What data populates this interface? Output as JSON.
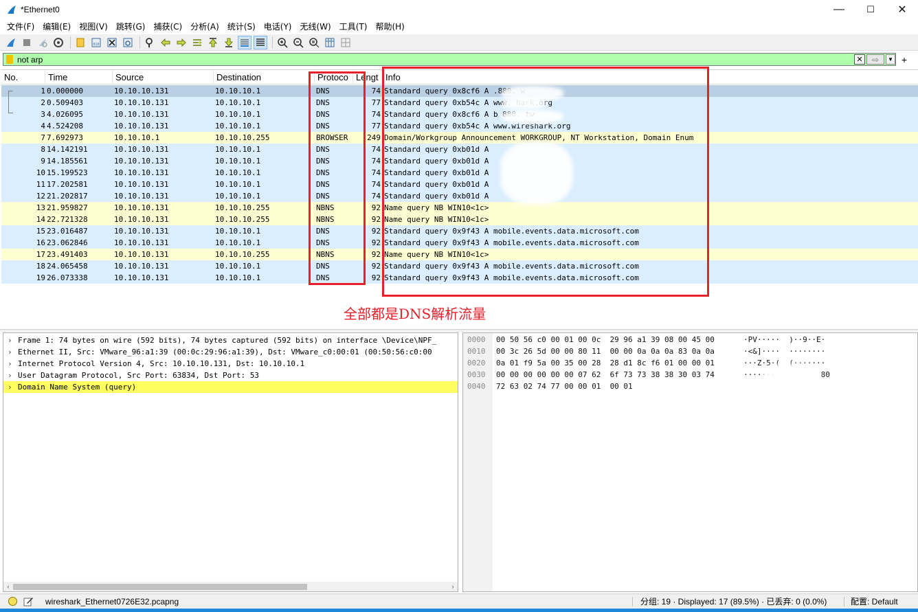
{
  "window": {
    "title": "*Ethernet0",
    "minimize_glyph": "—",
    "maximize_glyph": "☐",
    "close_glyph": "✕"
  },
  "menu": [
    "文件(F)",
    "编辑(E)",
    "视图(V)",
    "跳转(G)",
    "捕获(C)",
    "分析(A)",
    "统计(S)",
    "电话(Y)",
    "无线(W)",
    "工具(T)",
    "帮助(H)"
  ],
  "toolbar": {
    "icons": [
      "shark-fin-start-icon",
      "stop-capture-icon",
      "restart-capture-icon",
      "capture-options-icon",
      "open-file-icon",
      "save-file-icon",
      "close-file-icon",
      "reload-file-icon",
      "find-packet-icon",
      "go-back-icon",
      "go-forward-icon",
      "go-to-packet-icon",
      "go-first-icon",
      "go-last-icon",
      "auto-scroll-icon",
      "colorize-icon",
      "zoom-in-icon",
      "zoom-out-icon",
      "zoom-normal-icon",
      "resize-columns-icon"
    ]
  },
  "filter": {
    "value": "not arp",
    "clear_glyph": "✕",
    "apply_glyph": "⇨",
    "dropdown_glyph": "▼",
    "add_glyph": "+",
    "color": "#afffaf"
  },
  "packet_list": {
    "columns": [
      "No.",
      "Time",
      "Source",
      "Destination",
      "Protoco",
      "Lengt",
      "Info"
    ],
    "rows": [
      {
        "no": "1",
        "time": "0.000000",
        "src": "10.10.10.131",
        "dst": "10.10.10.1",
        "proto": "DNS",
        "len": "74",
        "info": "Standard query 0x8cf6 A    .880.    w",
        "type": "selected"
      },
      {
        "no": "2",
        "time": "0.509403",
        "src": "10.10.10.131",
        "dst": "10.10.10.1",
        "proto": "DNS",
        "len": "77",
        "info": "Standard query 0xb54c A www.    hark.org",
        "type": "dns"
      },
      {
        "no": "3",
        "time": "4.026095",
        "src": "10.10.10.131",
        "dst": "10.10.10.1",
        "proto": "DNS",
        "len": "74",
        "info": "Standard query 0x8cf6 A b    880.   tw",
        "type": "dns"
      },
      {
        "no": "4",
        "time": "4.524208",
        "src": "10.10.10.131",
        "dst": "10.10.10.1",
        "proto": "DNS",
        "len": "77",
        "info": "Standard query 0xb54c A www.wireshark.org",
        "type": "dns"
      },
      {
        "no": "7",
        "time": "7.692973",
        "src": "10.10.10.1",
        "dst": "10.10.10.255",
        "proto": "BROWSER",
        "len": "249",
        "info": "Domain/Workgroup Announcement WORKGROUP, NT Workstation, Domain Enum",
        "type": "nbns"
      },
      {
        "no": "8",
        "time": "14.142191",
        "src": "10.10.10.131",
        "dst": "10.10.10.1",
        "proto": "DNS",
        "len": "74",
        "info": "Standard query 0xb01d A",
        "type": "dns"
      },
      {
        "no": "9",
        "time": "14.185561",
        "src": "10.10.10.131",
        "dst": "10.10.10.1",
        "proto": "DNS",
        "len": "74",
        "info": "Standard query 0xb01d A",
        "type": "dns"
      },
      {
        "no": "10",
        "time": "15.199523",
        "src": "10.10.10.131",
        "dst": "10.10.10.1",
        "proto": "DNS",
        "len": "74",
        "info": "Standard query 0xb01d A",
        "type": "dns"
      },
      {
        "no": "11",
        "time": "17.202581",
        "src": "10.10.10.131",
        "dst": "10.10.10.1",
        "proto": "DNS",
        "len": "74",
        "info": "Standard query 0xb01d A",
        "type": "dns"
      },
      {
        "no": "12",
        "time": "21.202817",
        "src": "10.10.10.131",
        "dst": "10.10.10.1",
        "proto": "DNS",
        "len": "74",
        "info": "Standard query 0xb01d A",
        "type": "dns"
      },
      {
        "no": "13",
        "time": "21.959827",
        "src": "10.10.10.131",
        "dst": "10.10.10.255",
        "proto": "NBNS",
        "len": "92",
        "info": "Name query NB WIN10<1c>",
        "type": "nbns"
      },
      {
        "no": "14",
        "time": "22.721328",
        "src": "10.10.10.131",
        "dst": "10.10.10.255",
        "proto": "NBNS",
        "len": "92",
        "info": "Name query NB WIN10<1c>",
        "type": "nbns"
      },
      {
        "no": "15",
        "time": "23.016487",
        "src": "10.10.10.131",
        "dst": "10.10.10.1",
        "proto": "DNS",
        "len": "92",
        "info": "Standard query 0x9f43 A mobile.events.data.microsoft.com",
        "type": "dns"
      },
      {
        "no": "16",
        "time": "23.062846",
        "src": "10.10.10.131",
        "dst": "10.10.10.1",
        "proto": "DNS",
        "len": "92",
        "info": "Standard query 0x9f43 A mobile.events.data.microsoft.com",
        "type": "dns"
      },
      {
        "no": "17",
        "time": "23.491403",
        "src": "10.10.10.131",
        "dst": "10.10.10.255",
        "proto": "NBNS",
        "len": "92",
        "info": "Name query NB WIN10<1c>",
        "type": "nbns"
      },
      {
        "no": "18",
        "time": "24.065458",
        "src": "10.10.10.131",
        "dst": "10.10.10.1",
        "proto": "DNS",
        "len": "92",
        "info": "Standard query 0x9f43 A mobile.events.data.microsoft.com",
        "type": "dns"
      },
      {
        "no": "19",
        "time": "26.073338",
        "src": "10.10.10.131",
        "dst": "10.10.10.1",
        "proto": "DNS",
        "len": "92",
        "info": "Standard query 0x9f43 A mobile.events.data.microsoft.com",
        "type": "dns"
      }
    ]
  },
  "annotation": {
    "text": "全部都是DNS解析流量",
    "color": "#e8202a"
  },
  "details": {
    "chevron_glyph": "›",
    "rows": [
      {
        "text": "Frame 1: 74 bytes on wire (592 bits), 74 bytes captured (592 bits) on interface \\Device\\NPF_",
        "selected": false
      },
      {
        "text": "Ethernet II, Src: VMware_96:a1:39 (00:0c:29:96:a1:39), Dst: VMware_c0:00:01 (00:50:56:c0:00",
        "selected": false
      },
      {
        "text": "Internet Protocol Version 4, Src: 10.10.10.131, Dst: 10.10.10.1",
        "selected": false
      },
      {
        "text": "User Datagram Protocol, Src Port: 63834, Dst Port: 53",
        "selected": false
      },
      {
        "text": "Domain Name System (query)",
        "selected": true
      }
    ],
    "scroll_left": "‹",
    "scroll_right": "›"
  },
  "bytes": {
    "rows": [
      {
        "offset": "0000",
        "hex": "00 50 56 c0 00 01 00 0c  29 96 a1 39 08 00 45 00",
        "ascii": "·PV·····  )··9··E·"
      },
      {
        "offset": "0010",
        "hex": "00 3c 26 5d 00 00 80 11  00 00 0a 0a 0a 83 0a 0a",
        "ascii": "·<&]····  ········"
      },
      {
        "offset": "0020",
        "hex": "0a 01 f9 5a 00 35 00 28  28 d1 8c f6 01 00 00 01",
        "ascii": "···Z·5·(  (·······"
      },
      {
        "offset": "0030",
        "hex": "00 00 00 00 00 00 07 62  6f 73 73 38 38 30 03 74",
        "ascii": "·······          80"
      },
      {
        "offset": "0040",
        "hex": "72 63 02 74 77 00 00 01  00 01",
        "ascii": ""
      }
    ]
  },
  "status": {
    "file": "wireshark_Ethernet0726E32.pcapng",
    "stats": "分组: 19 · Displayed: 17 (89.5%) · 已丢弃: 0 (0.0%)",
    "profile": "配置: Default"
  }
}
